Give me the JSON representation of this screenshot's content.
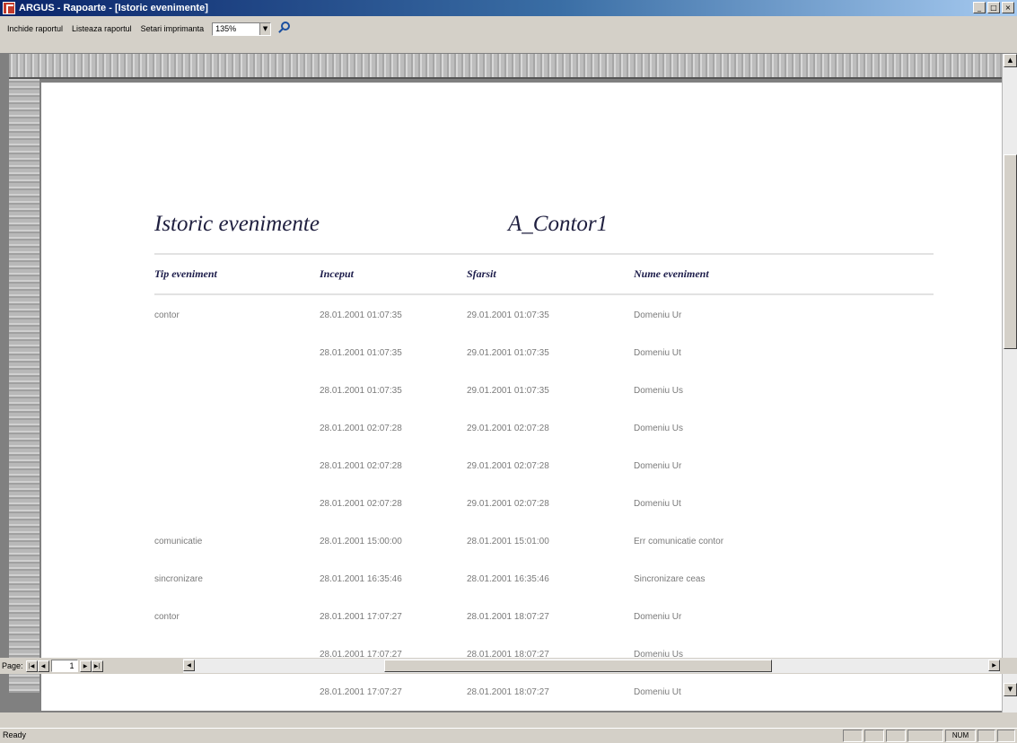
{
  "window": {
    "title": "ARGUS - Rapoarte - [Istoric evenimente]",
    "controls": [
      "_",
      "□",
      "×"
    ]
  },
  "toolbar": {
    "close_report": "Inchide raportul",
    "print_report": "Listeaza raportul",
    "print_setup": "Setari imprimanta",
    "zoom_value": "135%",
    "zoom_arrow": "▼",
    "search_icon": "magnifier-icon"
  },
  "report": {
    "title": "Istoric evenimente",
    "subject": "A_Contor1",
    "columns": [
      "Tip eveniment",
      "Inceput",
      "Sfarsit",
      "Nume eveniment"
    ],
    "rows": [
      [
        "contor",
        "28.01.2001 01:07:35",
        "29.01.2001 01:07:35",
        "Domeniu Ur"
      ],
      [
        "",
        "28.01.2001 01:07:35",
        "29.01.2001 01:07:35",
        "Domeniu Ut"
      ],
      [
        "",
        "28.01.2001 01:07:35",
        "29.01.2001 01:07:35",
        "Domeniu Us"
      ],
      [
        "",
        "28.01.2001 02:07:28",
        "29.01.2001 02:07:28",
        "Domeniu Us"
      ],
      [
        "",
        "28.01.2001 02:07:28",
        "29.01.2001 02:07:28",
        "Domeniu Ur"
      ],
      [
        "",
        "28.01.2001 02:07:28",
        "29.01.2001 02:07:28",
        "Domeniu Ut"
      ],
      [
        "comunicatie",
        "28.01.2001 15:00:00",
        "28.01.2001 15:01:00",
        "Err comunicatie contor"
      ],
      [
        "sincronizare",
        "28.01.2001 16:35:46",
        "28.01.2001 16:35:46",
        "Sincronizare ceas"
      ],
      [
        "contor",
        "28.01.2001 17:07:27",
        "28.01.2001 18:07:27",
        "Domeniu Ur"
      ],
      [
        "",
        "28.01.2001 17:07:27",
        "28.01.2001 18:07:27",
        "Domeniu Us"
      ],
      [
        "",
        "28.01.2001 17:07:27",
        "28.01.2001 18:07:27",
        "Domeniu Ut"
      ]
    ]
  },
  "navigation": {
    "page_label": "Page:",
    "current_page": "1",
    "first": "|◀",
    "prev": "◀",
    "next": "▶",
    "last": "▶|",
    "scroll_left": "◀",
    "scroll_right": "▶"
  },
  "scrollbar": {
    "up": "▲",
    "down": "▼"
  },
  "status": {
    "text": "Ready",
    "num": "NUM"
  }
}
